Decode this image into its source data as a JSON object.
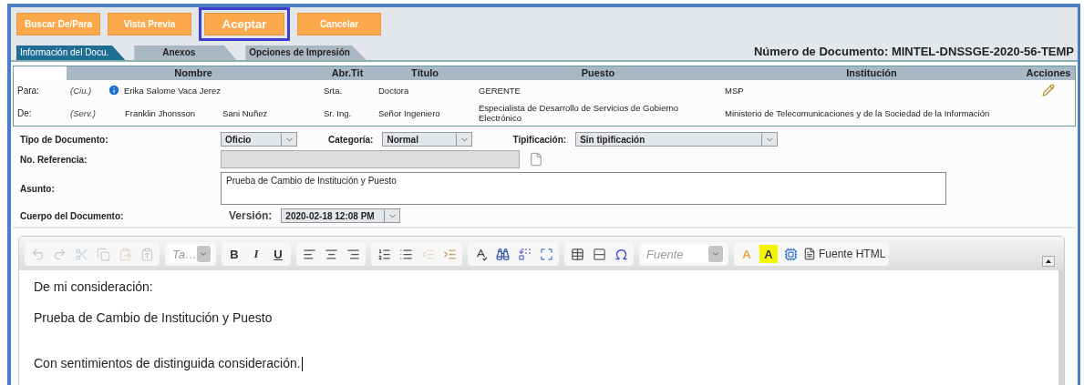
{
  "actions": [
    {
      "label": "Buscar De/Para",
      "primary": false
    },
    {
      "label": "Vista Previa",
      "primary": false
    },
    {
      "label": "Aceptar",
      "primary": true
    },
    {
      "label": "Cancelar",
      "primary": false
    }
  ],
  "tabs": [
    {
      "label": "Información del Docu.",
      "selected": true
    },
    {
      "label": "Anexos",
      "selected": false
    },
    {
      "label": "Opciones de Impresión",
      "selected": false
    }
  ],
  "document_number": "Número de Documento: MINTEL-DNSSGE-2020-56-TEMP",
  "recipients": {
    "columns": [
      "Nombre",
      "Abr.Tit",
      "Título",
      "Puesto",
      "Institución",
      "Acciones"
    ],
    "rows": [
      {
        "label": "Para:",
        "type": "(Ciu.)",
        "info": true,
        "names": [
          "Erika Salome Vaca Jerez"
        ],
        "abbreviation": "Srta.",
        "title": "Doctora",
        "position": "GERENTE",
        "institution": "MSP",
        "editable": true
      },
      {
        "label": "De:",
        "type": "(Serv.)",
        "info": false,
        "names": [
          "Franklin Jhonsson",
          "Sani Nuñez"
        ],
        "abbreviation": "Sr. Ing.",
        "title": "Señor Ingeniero",
        "position": "Especialista de Desarrollo de Servicios de Gobierno Electrónico",
        "institution": "Ministerio de Telecomunicaciones y de la Sociedad de la Información",
        "editable": false
      }
    ]
  },
  "form": {
    "document_type": {
      "label": "Tipo de Documento:",
      "value": "Oficio"
    },
    "category": {
      "label": "Categoría:",
      "value": "Normal"
    },
    "typification": {
      "label": "Tipificación:",
      "value": "Sin tipificación"
    },
    "reference": {
      "label": "No. Referencia:",
      "disabled": true
    },
    "subject": {
      "label": "Asunto:",
      "value": "Prueba de Cambio de Institución y Puesto"
    },
    "body_label": "Cuerpo del Documento:",
    "version": {
      "label": "Versión:",
      "value": "2020-02-18 12:08 PM"
    }
  },
  "editor": {
    "toolbar": [
      [
        {
          "kind": "icon",
          "disabled": true
        },
        {
          "kind": "icon",
          "disabled": true
        },
        {
          "kind": "icon",
          "disabled": true
        },
        {
          "kind": "icon",
          "disabled": true
        },
        {
          "kind": "icon",
          "disabled": true
        },
        {
          "kind": "icon",
          "disabled": true
        }
      ],
      [
        {
          "kind": "combo",
          "label": "Ta…"
        }
      ],
      [
        {
          "kind": "letter",
          "label": "B",
          "disabled": false
        },
        {
          "kind": "letter",
          "label": "I",
          "disabled": false
        },
        {
          "kind": "letter",
          "label": "U",
          "disabled": false
        }
      ],
      [
        {
          "kind": "icon",
          "disabled": false
        },
        {
          "kind": "icon",
          "disabled": false
        },
        {
          "kind": "icon",
          "disabled": false
        }
      ],
      [
        {
          "kind": "icon",
          "disabled": false
        },
        {
          "kind": "icon",
          "disabled": false
        },
        {
          "kind": "icon",
          "disabled": true
        },
        {
          "kind": "icon",
          "disabled": false
        }
      ],
      [
        {
          "kind": "icon",
          "disabled": false
        },
        {
          "kind": "icon",
          "disabled": false
        },
        {
          "kind": "icon",
          "disabled": false
        },
        {
          "kind": "icon",
          "disabled": false
        }
      ],
      [
        {
          "kind": "icon",
          "disabled": false
        },
        {
          "kind": "icon",
          "disabled": false
        },
        {
          "kind": "icon",
          "disabled": false
        }
      ],
      [
        {
          "kind": "combo",
          "label": "Fuente"
        }
      ],
      [
        {
          "kind": "letter",
          "label": "A",
          "disabled": false
        },
        {
          "kind": "letter",
          "label": "A",
          "disabled": false
        },
        {
          "kind": "icon",
          "disabled": false
        },
        {
          "kind": "source",
          "label": "Fuente HTML"
        }
      ]
    ],
    "paragraphs": [
      {
        "text": "De mi consideración:",
        "caret": false
      },
      {
        "text": "Prueba de Cambio de Institución y Puesto",
        "caret": false
      },
      {
        "text": "Con sentimientos de distinguida consideración.",
        "caret": true
      }
    ]
  }
}
